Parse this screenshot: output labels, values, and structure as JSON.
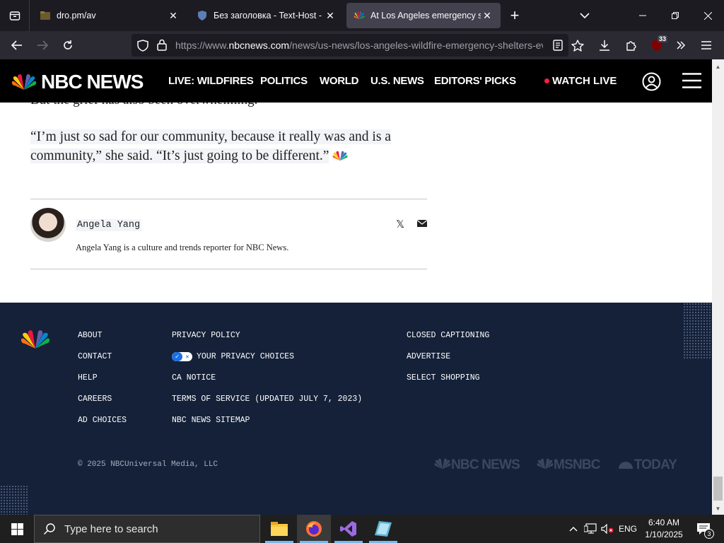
{
  "browser": {
    "tabs": [
      {
        "title": "dro.pm/av",
        "active": false
      },
      {
        "title": "Без заголовка - Text-Host - тек",
        "active": false
      },
      {
        "title": "At Los Angeles emergency shelt",
        "active": true
      }
    ],
    "new_tab": "+",
    "url_prefix": "https://www.",
    "url_host": "nbcnews.com",
    "url_path": "/news/us-news/los-angeles-wildfire-emergency-shelters-ev",
    "extension_badge": "33"
  },
  "nbc": {
    "logo_text": "NBC NEWS",
    "nav": [
      "LIVE: WILDFIRES",
      "POLITICS",
      "WORLD",
      "U.S. NEWS",
      "EDITORS' PICKS"
    ],
    "watch_live": "WATCH LIVE"
  },
  "article": {
    "cut_line": "But the grief has also been overwhelming.",
    "quote_line1": "“I’m just so sad for our community, because it really was and is a",
    "quote_line2": "community,” she said. “It’s just going to be different.”",
    "author_name": "Angela Yang",
    "author_bio": "Angela Yang is a culture and trends reporter for NBC News.",
    "share_x": "𝕏"
  },
  "footer": {
    "col1": [
      "ABOUT",
      "CONTACT",
      "HELP",
      "CAREERS",
      "AD CHOICES"
    ],
    "col2": [
      "PRIVACY POLICY",
      "YOUR PRIVACY CHOICES",
      "CA NOTICE",
      "TERMS OF SERVICE (UPDATED JULY 7, 2023)",
      "NBC NEWS SITEMAP"
    ],
    "col3": [
      "CLOSED CAPTIONING",
      "ADVERTISE",
      "SELECT SHOPPING"
    ],
    "copyright": "© 2025 NBCUniversal Media, LLC",
    "brands": [
      "NBC NEWS",
      "MSNBC",
      "TODAY"
    ]
  },
  "taskbar": {
    "search_placeholder": "Type here to search",
    "language": "ENG",
    "time": "6:40 AM",
    "date": "1/10/2025",
    "notification_count": "3"
  },
  "colors": {
    "nbc_black": "#000000",
    "footer_navy": "#142139",
    "live_red": "#ff1f3d",
    "browser_dark": "#1c1b22"
  }
}
